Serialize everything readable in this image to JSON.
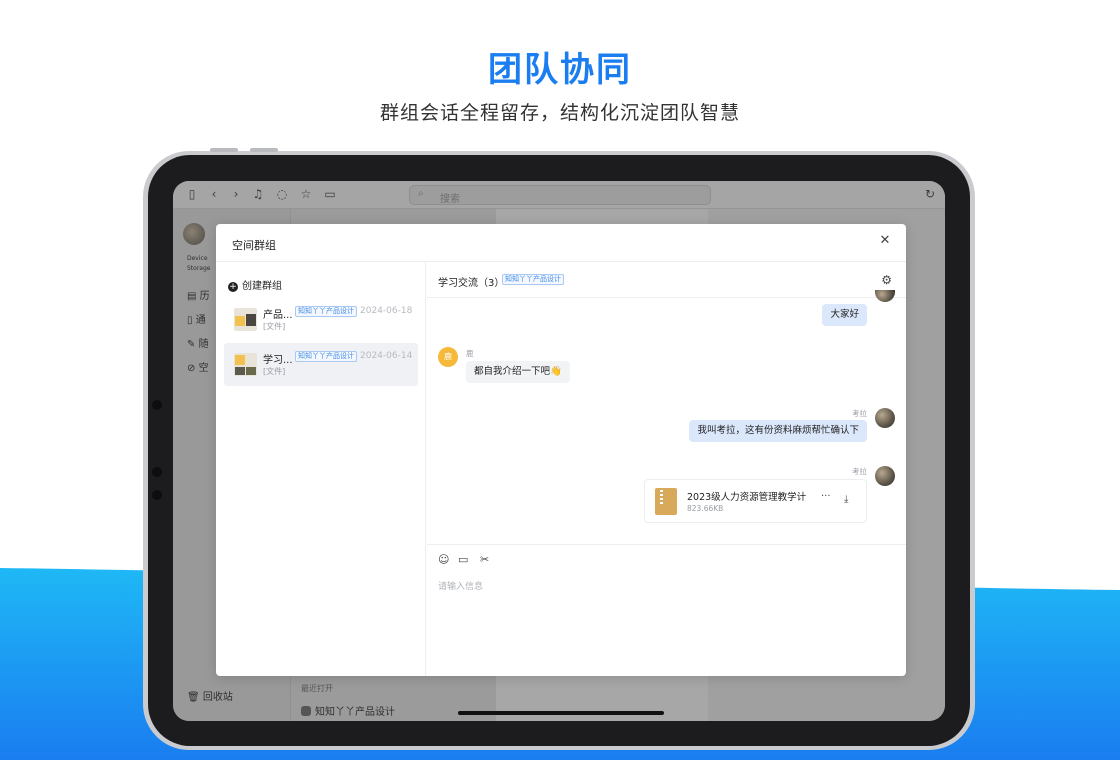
{
  "hero": {
    "title": "团队协同",
    "subtitle": "群组会话全程留存，结构化沉淀团队智慧"
  },
  "colors": {
    "brand_blue": "#1a7df0",
    "wave_light": "#1fb8f5",
    "wave_dark": "#1a7df0",
    "bubble_blue": "#dbe7fb",
    "tag_blue": "#3e8be8"
  },
  "app": {
    "search_placeholder": "搜索",
    "sidebar": {
      "storage_line1": "Device",
      "storage_line2": "Storage",
      "items": [
        {
          "icon": "calendar-icon",
          "label": "历"
        },
        {
          "icon": "book-icon",
          "label": "通"
        },
        {
          "icon": "edit-icon",
          "label": "随"
        },
        {
          "icon": "link-icon",
          "label": "空"
        }
      ],
      "trash_label": "回收站"
    },
    "recent_label": "最近打开",
    "recent_item": "知知丫丫产品设计"
  },
  "modal": {
    "title": "空间群组",
    "create_group_label": "创建群组",
    "groups": [
      {
        "name": "产品...",
        "tag": "知知丫丫产品设计",
        "date": "2024-06-18",
        "last_msg": "[文件]"
      },
      {
        "name": "学习...",
        "tag": "知知丫丫产品设计",
        "date": "2024-06-14",
        "last_msg": "[文件]"
      }
    ],
    "chat": {
      "title": "学习交流（3）",
      "tag": "知知丫丫产品设计",
      "messages": [
        {
          "side": "right",
          "sender": "",
          "text": "大家好"
        },
        {
          "side": "left",
          "sender": "鹿",
          "avatar_text": "鹿",
          "text": "都自我介绍一下吧👋"
        },
        {
          "side": "right",
          "sender": "考拉",
          "text": "我叫考拉，这有份资料麻烦帮忙确认下"
        },
        {
          "side": "right",
          "sender": "考拉",
          "file": {
            "name": "2023级人力资源管理教学计",
            "size": "823.66KB",
            "more": "..."
          }
        }
      ],
      "input_placeholder": "请输入信息"
    }
  }
}
